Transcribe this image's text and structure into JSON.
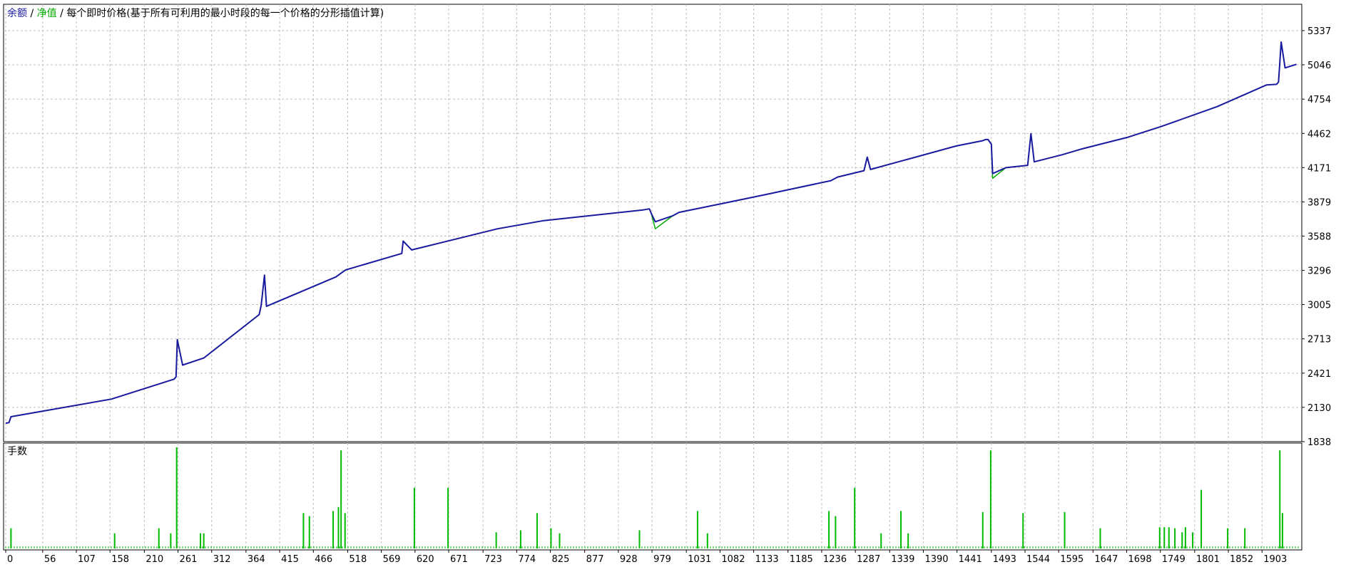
{
  "legend": {
    "balance": "余额",
    "separator": " / ",
    "equity": "净值",
    "description": "每个即时价格(基于所有可利用的最小时段的每一个价格的分形插值计算)",
    "balance_color": "#1a1aa0",
    "equity_color": "#00aa00"
  },
  "lots_panel": {
    "title": "手数",
    "color": "#00bb00"
  },
  "chart_data": [
    {
      "type": "line",
      "ylim": [
        1838,
        5410
      ],
      "yticks": [
        5337,
        5046,
        4754,
        4462,
        4171,
        3879,
        3588,
        3296,
        3005,
        2713,
        2421,
        2130,
        1838
      ],
      "xlim": [
        0,
        1960
      ],
      "xticks": [
        0,
        56,
        107,
        158,
        210,
        261,
        312,
        364,
        415,
        466,
        518,
        569,
        620,
        671,
        723,
        774,
        825,
        877,
        928,
        979,
        1031,
        1082,
        1133,
        1185,
        1236,
        1287,
        1339,
        1390,
        1441,
        1493,
        1544,
        1595,
        1647,
        1698,
        1749,
        1801,
        1852,
        1903
      ],
      "grid": true,
      "series": [
        {
          "name": "余额",
          "color": "#1a1aa0",
          "x": [
            0,
            5,
            8,
            160,
            255,
            258,
            260,
            268,
            300,
            384,
            387,
            392,
            395,
            500,
            515,
            600,
            602,
            615,
            745,
            815,
            965,
            975,
            978,
            984,
            1010,
            1020,
            1090,
            1150,
            1250,
            1260,
            1300,
            1305,
            1310,
            1440,
            1480,
            1484,
            1488,
            1493,
            1495,
            1515,
            1548,
            1553,
            1558,
            1600,
            1630,
            1700,
            1750,
            1835,
            1910,
            1925,
            1928,
            1932,
            1938,
            1955
          ],
          "y": [
            1995,
            2000,
            2050,
            2200,
            2370,
            2390,
            2705,
            2490,
            2550,
            2920,
            3000,
            3255,
            2990,
            3240,
            3300,
            3440,
            3545,
            3470,
            3650,
            3720,
            3810,
            3820,
            3780,
            3710,
            3760,
            3790,
            3870,
            3940,
            4060,
            4090,
            4145,
            4260,
            4155,
            4355,
            4400,
            4410,
            4410,
            4370,
            4120,
            4170,
            4190,
            4460,
            4220,
            4280,
            4330,
            4430,
            4520,
            4690,
            4875,
            4880,
            4900,
            5240,
            5020,
            5050
          ]
        },
        {
          "name": "净值",
          "color": "#00aa00",
          "x": [
            0,
            5,
            8,
            160,
            255,
            258,
            260,
            268,
            300,
            384,
            387,
            392,
            395,
            500,
            515,
            600,
            602,
            615,
            745,
            815,
            965,
            975,
            978,
            984,
            1010,
            1020,
            1090,
            1150,
            1250,
            1260,
            1300,
            1305,
            1310,
            1440,
            1480,
            1484,
            1488,
            1493,
            1495,
            1515,
            1548,
            1553,
            1558,
            1600,
            1630,
            1700,
            1750,
            1835,
            1910,
            1925,
            1928,
            1932,
            1938,
            1955
          ],
          "y": [
            1995,
            2000,
            2050,
            2200,
            2370,
            2390,
            2705,
            2490,
            2550,
            2920,
            3000,
            3255,
            2990,
            3240,
            3300,
            3440,
            3545,
            3470,
            3650,
            3720,
            3810,
            3820,
            3780,
            3650,
            3760,
            3790,
            3870,
            3940,
            4060,
            4090,
            4145,
            4260,
            4155,
            4355,
            4400,
            4410,
            4410,
            4370,
            4080,
            4170,
            4190,
            4460,
            4220,
            4280,
            4330,
            4430,
            4520,
            4690,
            4875,
            4880,
            4900,
            5240,
            5020,
            5050
          ]
        }
      ]
    },
    {
      "type": "bar",
      "ylim": [
        0,
        1
      ],
      "xlim": [
        0,
        1960
      ],
      "series": [
        {
          "name": "手数",
          "x": [
            8,
            165,
            232,
            250,
            259,
            295,
            300,
            451,
            460,
            496,
            504,
            508,
            514,
            619,
            670,
            743,
            780,
            805,
            826,
            839,
            960,
            1048,
            1063,
            1247,
            1257,
            1286,
            1326,
            1356,
            1367,
            1480,
            1492,
            1541,
            1604,
            1658,
            1748,
            1755,
            1762,
            1771,
            1782,
            1787,
            1798,
            1811,
            1851,
            1877,
            1930,
            1934
          ],
          "values": [
            0.2,
            0.15,
            0.2,
            0.15,
            1.0,
            0.15,
            0.15,
            0.35,
            0.32,
            0.37,
            0.41,
            0.97,
            0.35,
            0.6,
            0.6,
            0.16,
            0.18,
            0.35,
            0.2,
            0.15,
            0.18,
            0.37,
            0.15,
            0.37,
            0.32,
            0.6,
            0.15,
            0.37,
            0.15,
            0.36,
            0.97,
            0.35,
            0.36,
            0.2,
            0.21,
            0.21,
            0.21,
            0.2,
            0.16,
            0.21,
            0.16,
            0.58,
            0.2,
            0.2,
            0.97,
            0.35
          ]
        }
      ]
    }
  ]
}
